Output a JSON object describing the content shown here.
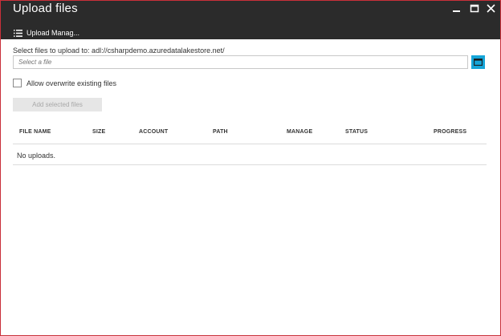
{
  "window": {
    "title": "Upload files",
    "menu_label": "Upload Manag...",
    "frame_color": "#c9303a",
    "titlebar_color": "#2b2b2b"
  },
  "form": {
    "instruction": "Select files to upload to: adl://csharpdemo.azuredatalakestore.net/",
    "file_placeholder": "Select a file",
    "overwrite_label": "Allow overwrite existing files",
    "overwrite_checked": false,
    "add_button_label": "Add selected files",
    "accent_color": "#16a5d8"
  },
  "table": {
    "columns": [
      "FILE NAME",
      "SIZE",
      "ACCOUNT",
      "PATH",
      "MANAGE",
      "STATUS",
      "PROGRESS"
    ],
    "empty_message": "No uploads."
  },
  "icons": [
    "hamburger-list-icon",
    "minimize-icon",
    "maximize-icon",
    "close-icon",
    "folder-browse-icon"
  ]
}
